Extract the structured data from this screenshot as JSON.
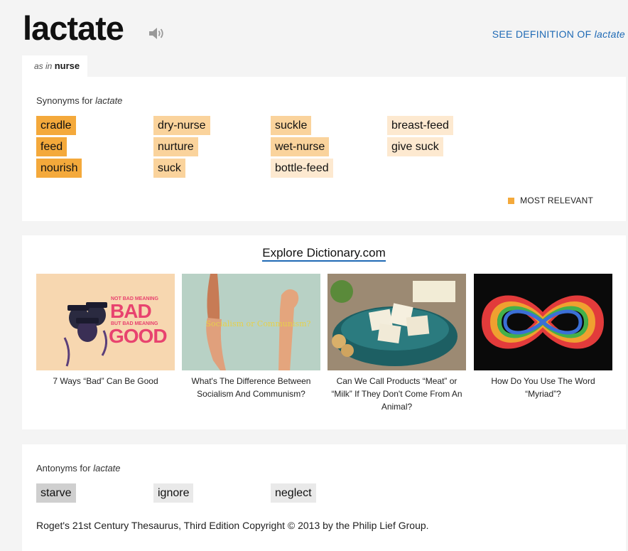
{
  "header": {
    "headword": "lactate",
    "speaker_icon": "speaker-icon",
    "see_definition_prefix": "SEE DEFINITION OF",
    "see_definition_word": "lactate"
  },
  "sense_tab": {
    "prefix": "as in",
    "word": "nurse"
  },
  "synonyms": {
    "label_prefix": "Synonyms for",
    "label_word": "lactate",
    "words": [
      {
        "text": "cradle",
        "relevance": 3
      },
      {
        "text": "feed",
        "relevance": 3
      },
      {
        "text": "nourish",
        "relevance": 3
      },
      {
        "text": "dry-nurse",
        "relevance": 2
      },
      {
        "text": "nurture",
        "relevance": 2
      },
      {
        "text": "suck",
        "relevance": 2
      },
      {
        "text": "suckle",
        "relevance": 2
      },
      {
        "text": "wet-nurse",
        "relevance": 2
      },
      {
        "text": "bottle-feed",
        "relevance": 1
      },
      {
        "text": "breast-feed",
        "relevance": 1
      },
      {
        "text": "give suck",
        "relevance": 1
      }
    ],
    "legend_label": "MOST RELEVANT",
    "colors": {
      "high": "#f4a93b",
      "mid": "#fad39c",
      "low": "#fde9d0"
    }
  },
  "explore": {
    "title": "Explore Dictionary.com",
    "tiles": [
      {
        "caption": "7 Ways “Bad” Can Be Good",
        "image_text_1": "BAD",
        "image_text_2": "GOOD",
        "image_small_1": "NOT BAD MEANING",
        "image_small_2": "BUT BAD MEANING"
      },
      {
        "caption": "What's The Difference Between Socialism And Communism?",
        "image_text_1": "Socialism or Communism?"
      },
      {
        "caption": "Can We Call Products “Meat” or “Milk” If They Don't Come From An Animal?"
      },
      {
        "caption": "How Do You Use The Word “Myriad”?"
      }
    ]
  },
  "antonyms": {
    "label_prefix": "Antonyms for",
    "label_word": "lactate",
    "words": [
      {
        "text": "starve",
        "strong": true
      },
      {
        "text": "ignore",
        "strong": false
      },
      {
        "text": "neglect",
        "strong": false
      }
    ]
  },
  "footer": {
    "copyright": "Roget's 21st Century Thesaurus, Third Edition Copyright © 2013 by the Philip Lief Group."
  }
}
